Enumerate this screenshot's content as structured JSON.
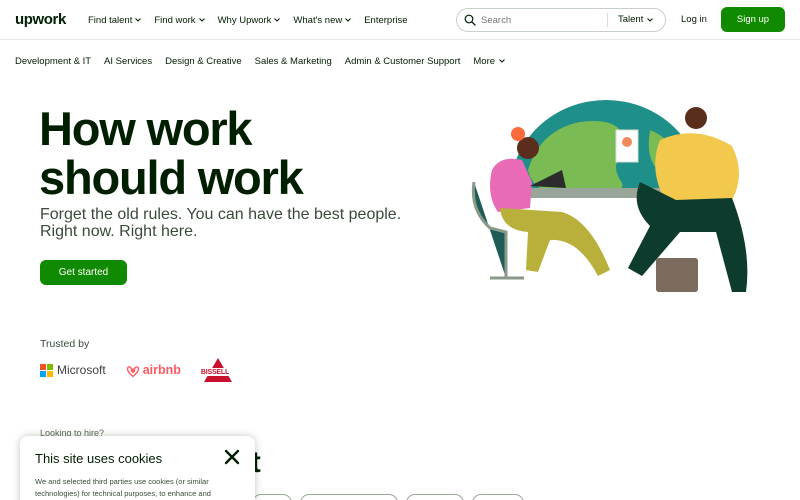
{
  "brand": {
    "logo_text": "upwork",
    "accent": "#108a00",
    "text": "#001e00"
  },
  "nav": {
    "items": [
      {
        "label": "Find talent",
        "dropdown": true
      },
      {
        "label": "Find work",
        "dropdown": true
      },
      {
        "label": "Why Upwork",
        "dropdown": true
      },
      {
        "label": "What's new",
        "dropdown": true
      },
      {
        "label": "Enterprise",
        "dropdown": false
      }
    ],
    "search_placeholder": "Search",
    "search_scope": "Talent",
    "login": "Log in",
    "signup": "Sign up"
  },
  "categories": {
    "items": [
      "Development & IT",
      "AI Services",
      "Design & Creative",
      "Sales & Marketing",
      "Admin & Customer Support"
    ],
    "more": "More"
  },
  "hero": {
    "title_line1": "How work",
    "title_line2": "should work",
    "subtitle_line1": "Forget the old rules. You can have the best people.",
    "subtitle_line2": "Right now. Right here.",
    "cta": "Get started"
  },
  "trusted": {
    "label": "Trusted by",
    "logos": [
      {
        "name": "Microsoft",
        "icon": "microsoft-logo"
      },
      {
        "name": "airbnb",
        "icon": "airbnb-logo"
      },
      {
        "name": "BISSELL",
        "icon": "bissell-logo"
      }
    ]
  },
  "section": {
    "eyebrow": "Looking to hire?",
    "heading_tail": "nt"
  },
  "cookie": {
    "title": "This site uses cookies",
    "body_line1": "We and selected third parties use cookies (or similar",
    "body_line2": "technologies) for technical purposes, to enhance and",
    "close_icon": "close-icon"
  },
  "icons": [
    "search-icon",
    "chevron-down-icon",
    "close-icon",
    "microsoft-logo",
    "airbnb-logo",
    "bissell-logo"
  ]
}
